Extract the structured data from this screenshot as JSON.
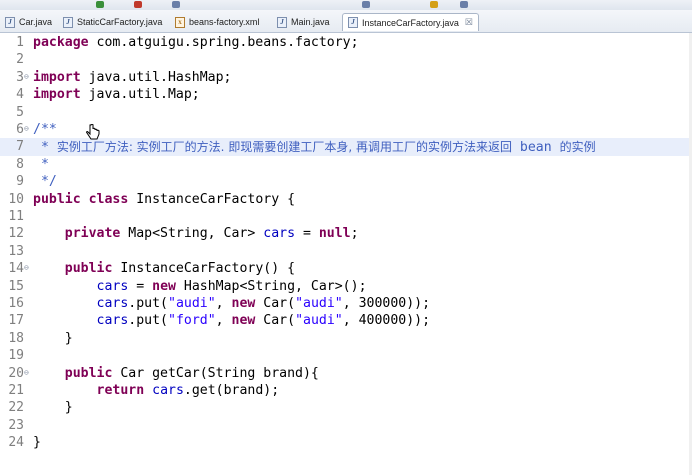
{
  "tabs": [
    {
      "label": "Car.java",
      "type": "java",
      "active": false
    },
    {
      "label": "StaticCarFactory.java",
      "type": "java",
      "active": false
    },
    {
      "label": "beans-factory.xml",
      "type": "xml",
      "active": false
    },
    {
      "label": "Main.java",
      "type": "java",
      "active": false
    },
    {
      "label": "InstanceCarFactory.java",
      "type": "java",
      "active": true
    }
  ],
  "tab_icons": {
    "java": "J",
    "xml": "x"
  },
  "close_glyph": "☒",
  "editor": {
    "highlighted_line": 7,
    "lines": [
      {
        "n": "1",
        "fold": "",
        "tokens": [
          [
            "kw",
            "package"
          ],
          [
            "t",
            " com.atguigu.spring.beans.factory;"
          ]
        ]
      },
      {
        "n": "2",
        "fold": "",
        "tokens": []
      },
      {
        "n": "3",
        "fold": "⊖",
        "tokens": [
          [
            "kw",
            "import"
          ],
          [
            "t",
            " java.util.HashMap;"
          ]
        ]
      },
      {
        "n": "4",
        "fold": "",
        "tokens": [
          [
            "kw",
            "import"
          ],
          [
            "t",
            " java.util.Map;"
          ]
        ]
      },
      {
        "n": "5",
        "fold": "",
        "tokens": []
      },
      {
        "n": "6",
        "fold": "⊖",
        "tokens": [
          [
            "cmt",
            "/**"
          ]
        ]
      },
      {
        "n": "7",
        "fold": "",
        "tokens": [
          [
            "cmt",
            " * "
          ],
          [
            "cn",
            "实例工厂方法: 实例工厂的方法. 即现需要创建工厂本身, 再调用工厂的实例方法来返回"
          ],
          [
            "cmt",
            " bean "
          ],
          [
            "cn",
            "的实例"
          ]
        ]
      },
      {
        "n": "8",
        "fold": "",
        "tokens": [
          [
            "cmt",
            " *"
          ]
        ]
      },
      {
        "n": "9",
        "fold": "",
        "tokens": [
          [
            "cmt",
            " */"
          ]
        ]
      },
      {
        "n": "10",
        "fold": "",
        "tokens": [
          [
            "kw",
            "public class"
          ],
          [
            "t",
            " InstanceCarFactory {"
          ]
        ]
      },
      {
        "n": "11",
        "fold": "",
        "tokens": []
      },
      {
        "n": "12",
        "fold": "",
        "tokens": [
          [
            "t",
            "    "
          ],
          [
            "kw",
            "private"
          ],
          [
            "t",
            " Map<String, Car> "
          ],
          [
            "fld",
            "cars"
          ],
          [
            "t",
            " = "
          ],
          [
            "kw",
            "null"
          ],
          [
            "t",
            ";"
          ]
        ]
      },
      {
        "n": "13",
        "fold": "",
        "tokens": []
      },
      {
        "n": "14",
        "fold": "⊖",
        "tokens": [
          [
            "t",
            "    "
          ],
          [
            "kw",
            "public"
          ],
          [
            "t",
            " InstanceCarFactory() {"
          ]
        ]
      },
      {
        "n": "15",
        "fold": "",
        "tokens": [
          [
            "t",
            "        "
          ],
          [
            "fld",
            "cars"
          ],
          [
            "t",
            " = "
          ],
          [
            "kw",
            "new"
          ],
          [
            "t",
            " HashMap<String, Car>();"
          ]
        ]
      },
      {
        "n": "16",
        "fold": "",
        "tokens": [
          [
            "t",
            "        "
          ],
          [
            "fld",
            "cars"
          ],
          [
            "t",
            ".put("
          ],
          [
            "str",
            "\"audi\""
          ],
          [
            "t",
            ", "
          ],
          [
            "kw",
            "new"
          ],
          [
            "t",
            " Car("
          ],
          [
            "str",
            "\"audi\""
          ],
          [
            "t",
            ", 300000));"
          ]
        ]
      },
      {
        "n": "17",
        "fold": "",
        "tokens": [
          [
            "t",
            "        "
          ],
          [
            "fld",
            "cars"
          ],
          [
            "t",
            ".put("
          ],
          [
            "str",
            "\"ford\""
          ],
          [
            "t",
            ", "
          ],
          [
            "kw",
            "new"
          ],
          [
            "t",
            " Car("
          ],
          [
            "str",
            "\"audi\""
          ],
          [
            "t",
            ", 400000));"
          ]
        ]
      },
      {
        "n": "18",
        "fold": "",
        "tokens": [
          [
            "t",
            "    }"
          ]
        ]
      },
      {
        "n": "19",
        "fold": "",
        "tokens": []
      },
      {
        "n": "20",
        "fold": "⊖",
        "tokens": [
          [
            "t",
            "    "
          ],
          [
            "kw",
            "public"
          ],
          [
            "t",
            " Car getCar(String brand){"
          ]
        ]
      },
      {
        "n": "21",
        "fold": "",
        "tokens": [
          [
            "t",
            "        "
          ],
          [
            "kw",
            "return"
          ],
          [
            "t",
            " "
          ],
          [
            "fld",
            "cars"
          ],
          [
            "t",
            ".get(brand);"
          ]
        ]
      },
      {
        "n": "22",
        "fold": "",
        "tokens": [
          [
            "t",
            "    }"
          ]
        ]
      },
      {
        "n": "23",
        "fold": "",
        "tokens": []
      },
      {
        "n": "24",
        "fold": "",
        "tokens": [
          [
            "t",
            "}"
          ]
        ]
      }
    ]
  },
  "colors": {
    "keyword": "#7f0055",
    "string": "#2a00ff",
    "field": "#0000c0",
    "comment": "#3f5fbf",
    "line_number": "#7f7f7f",
    "highlight": "#e8eefb"
  }
}
